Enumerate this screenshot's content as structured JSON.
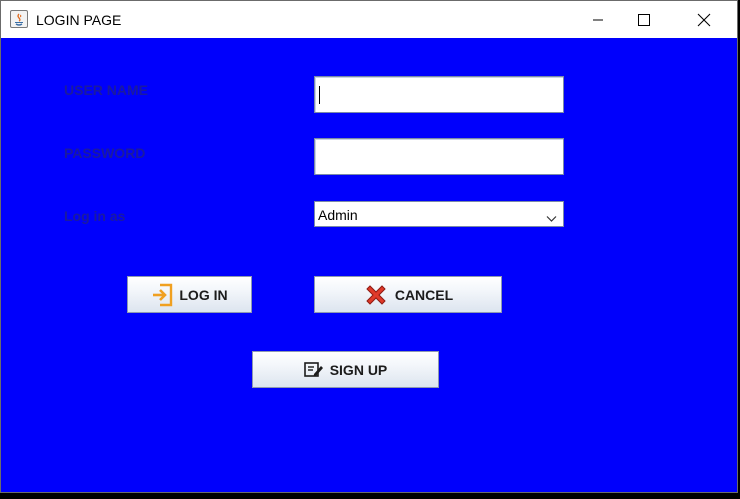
{
  "window": {
    "title": "LOGIN PAGE"
  },
  "form": {
    "username_label": "USER NAME",
    "username_value": "",
    "password_label": "PASSWORD",
    "password_value": "",
    "login_as_label": "Log in as",
    "login_as_selected": "Admin"
  },
  "buttons": {
    "login": "LOG IN",
    "cancel": "CANCEL",
    "signup": "SIGN UP"
  },
  "colors": {
    "background": "#0000fc",
    "label": "#1a1aa0"
  }
}
